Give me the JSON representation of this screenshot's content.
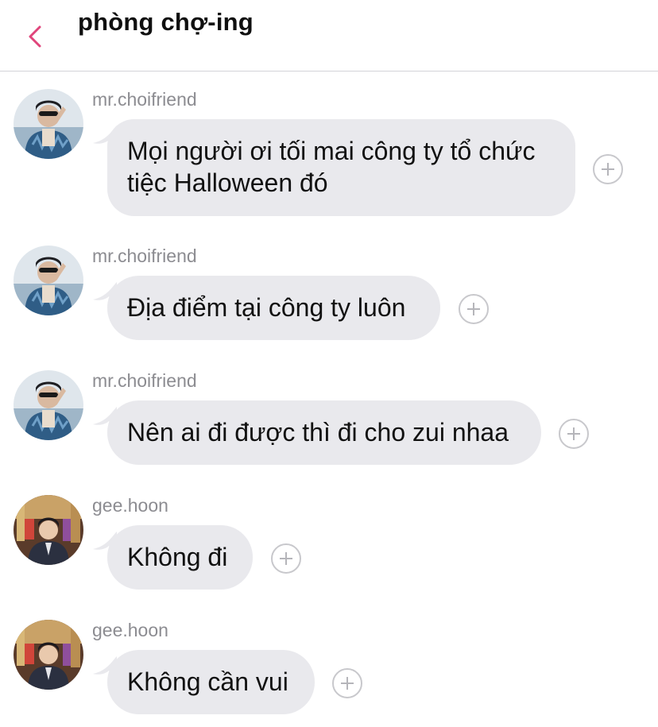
{
  "header": {
    "title": "phòng chợ-ing",
    "back_icon": "chevron-left-icon",
    "accent_color": "#e0457b"
  },
  "messages": [
    {
      "sender": "mr.choifriend",
      "text_lines": [
        "Mọi người ơi tối mai công ty tổ chức",
        "tiệc Halloween đó"
      ],
      "avatar": "avatar-mr-choifriend",
      "react_icon": "plus-icon"
    },
    {
      "sender": "mr.choifriend",
      "text": "Địa điểm tại công ty luôn",
      "avatar": "avatar-mr-choifriend",
      "react_icon": "plus-icon"
    },
    {
      "sender": "mr.choifriend",
      "text": "Nên ai đi được thì đi cho zui nhaa",
      "avatar": "avatar-mr-choifriend",
      "react_icon": "plus-icon"
    },
    {
      "sender": "gee.hoon",
      "text": "Không đi",
      "avatar": "avatar-gee-hoon",
      "react_icon": "plus-icon"
    },
    {
      "sender": "gee.hoon",
      "text": "Không cần vui",
      "avatar": "avatar-gee-hoon",
      "react_icon": "plus-icon"
    }
  ],
  "colors": {
    "bubble_bg": "#e9e9ed",
    "sender_text": "#8c8c91",
    "divider": "#d4d4d8"
  }
}
